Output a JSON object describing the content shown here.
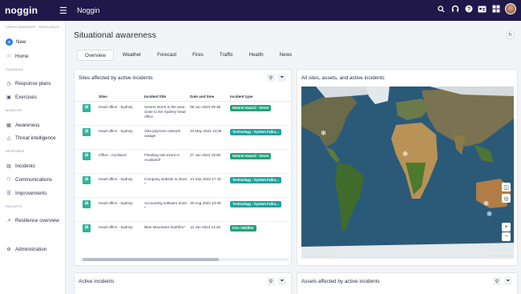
{
  "app": {
    "logo_text": "noggin",
    "title": "Noggin"
  },
  "sidebar": {
    "subtitle": "CRISIS MANAGER - RESILIENCE",
    "new_label": "New",
    "home_label": "Home",
    "sections": [
      {
        "heading": "PLANNING",
        "items": [
          "Response plans",
          "Exercises"
        ]
      },
      {
        "heading": "MONITOR",
        "items": [
          "Awareness",
          "Threat intelligence"
        ]
      },
      {
        "heading": "RESPONSE",
        "items": [
          "Incidents",
          "Communications",
          "Improvements"
        ]
      },
      {
        "heading": "INSIGHTS",
        "items": [
          "Resilience overview"
        ]
      }
    ],
    "admin_label": "Administration"
  },
  "page": {
    "title": "Situational awareness"
  },
  "tabs": [
    "Overview",
    "Weather",
    "Forecast",
    "Fires",
    "Traffic",
    "Health",
    "News"
  ],
  "sites_card": {
    "title": "Sites affected by active incidents",
    "columns": [
      "Sites",
      "Incident title",
      "Date and time",
      "Incident type"
    ],
    "rows": [
      {
        "site": "Head office - Sydney",
        "title": "Severe storm in the area close to the Sydney head office",
        "date": "08 Jun 2023 09:38",
        "type": "Natural Hazard - Storm"
      },
      {
        "site": "Head office - Sydney",
        "title": "Visa payment network outage",
        "date": "23 May 2023 14:08",
        "type": "Technology - System Failur..."
      },
      {
        "site": "Office - Auckland",
        "title": "Flooding rain event in Auckland*",
        "date": "27 Jan 2023 19:00",
        "type": "Natural Hazard - Storm"
      },
      {
        "site": "Head office - Sydney",
        "title": "Company website is down *",
        "date": "14 Sep 2022 17:10",
        "type": "Technology - System Failur..."
      },
      {
        "site": "Head office - Sydney",
        "title": "Accounting software down *",
        "date": "25 Aug 2022 10:09",
        "type": "Technology - System Failur..."
      },
      {
        "site": "Head office - Sydney",
        "title": "Blue Mountains bushfire*",
        "date": "12 Jan 2023 14:46",
        "type": "Fire / Wildfire"
      }
    ]
  },
  "map_card": {
    "title": "All sites, assets, and active incidents",
    "attribution_left": "Earthstar Geographics",
    "attribution_right": "Powered by Esri"
  },
  "active_incidents": {
    "title": "Active incidents"
  },
  "assets_card": {
    "title": "Assets affected by active incidents"
  }
}
